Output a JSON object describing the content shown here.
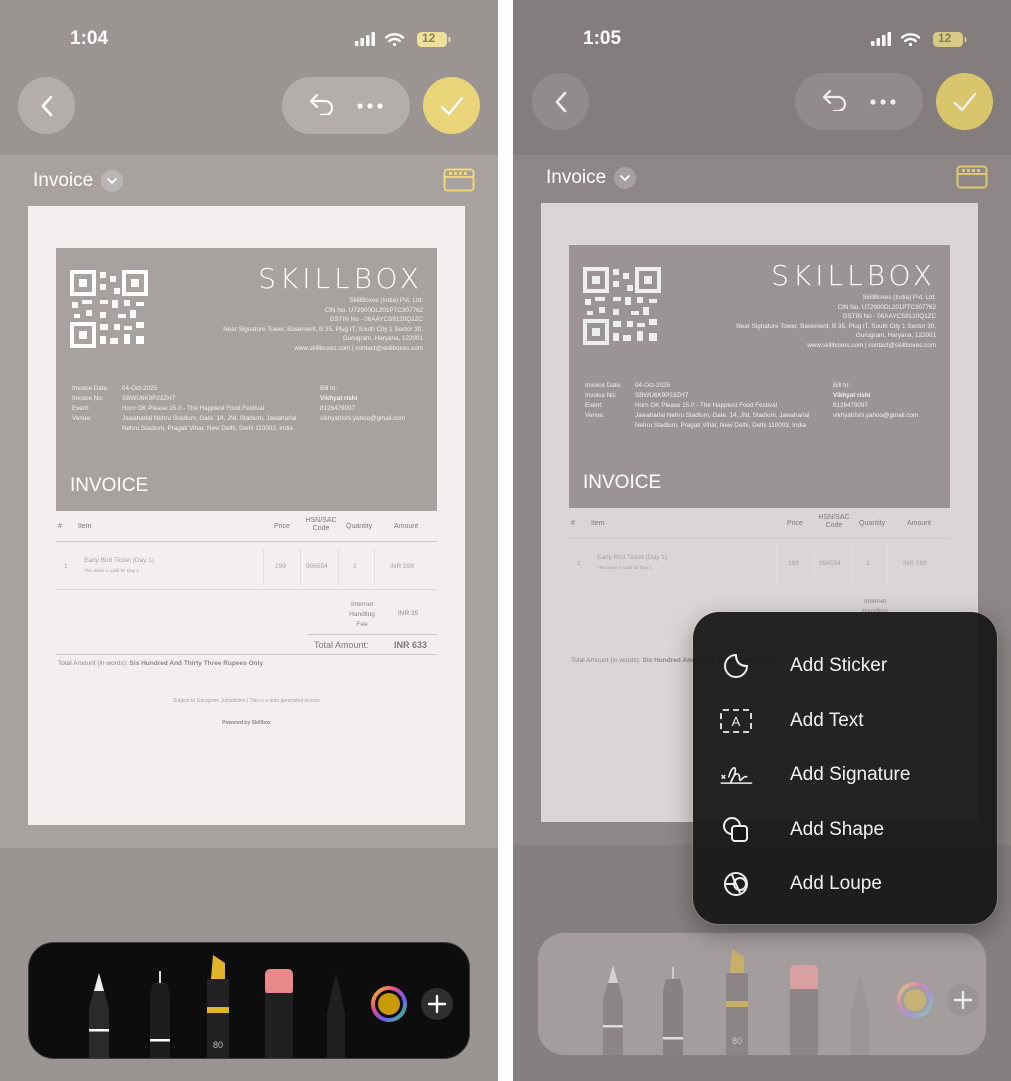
{
  "panels": [
    {
      "time": "1:04",
      "battery": "12",
      "doc_title": "Invoice",
      "document": {
        "brand": "SKILLBOX",
        "company_lines": [
          "SkillBoxes (India) Pvt. Ltd.",
          "CIN No. U72900DL201PTC307762",
          "GSTIN No - 06AAYCS9120Q1ZC",
          "Near Signature Tower, Basement, B 35, Plug IT, South City 1 Sector 30,",
          "Gurugram, Haryana, 122001",
          "www.skillboxes.com | contact@skillboxes.com"
        ],
        "meta": [
          {
            "label": "Invoice Date:",
            "value": "04-Oct-2025"
          },
          {
            "label": "Invoice No:",
            "value": "SBWU6K9P23ZH7"
          },
          {
            "label": "Event:",
            "value": "Horn OK Please 15.0 - The Happiest Food Festival"
          },
          {
            "label": "Venue:",
            "value": "Jawaharlal Nehru Stadium, Gate. 14, JNL Stadium, Jawaharlal Nehru Stadium, Pragati Vihar, New Delhi, Delhi 110003, India"
          }
        ],
        "bill_to": {
          "label": "Bill to:",
          "name": "Vikhyat rishi",
          "phone": "8126479097",
          "email": "vikhyatrishi.yahoo@gmail.com"
        },
        "invoice_label": "INVOICE",
        "columns": [
          "#",
          "Item",
          "Price",
          "HSN/SAC Code",
          "Quantity",
          "Amount"
        ],
        "row": {
          "num": "1",
          "item": "Early Bird Ticket (Day 1)",
          "note": "This ticket is valid for Day 1.",
          "price": "299",
          "code": "996554",
          "qty": "2",
          "amount": "INR 598"
        },
        "fee_label": "Internet Handling Fee",
        "fee_amount": "INR 35",
        "total_label": "Total Amount:",
        "total_value": "INR 633",
        "words_label": "Total Amount (in words):",
        "words_value": "Six Hundred And Thirty Three Rupees Only",
        "footer": "Subject to Gurugram Jurisdiction | This is a auto generated invoice",
        "powered": "Powered by Skillbox"
      },
      "marker_width": "80"
    },
    {
      "time": "1:05",
      "battery": "12",
      "doc_title": "Invoice",
      "marker_width": "80"
    }
  ],
  "menu": [
    {
      "label": "Add Sticker",
      "icon": "sticker-icon"
    },
    {
      "label": "Add Text",
      "icon": "text-box-icon"
    },
    {
      "label": "Add Signature",
      "icon": "signature-icon"
    },
    {
      "label": "Add Shape",
      "icon": "shape-icon"
    },
    {
      "label": "Add Loupe",
      "icon": "loupe-icon"
    }
  ],
  "colors": {
    "done_button": "#e9d47a",
    "menu_bg": "#161616",
    "toolbar_bg": "#0d0d0d",
    "highlighter": "#e0b52a",
    "eraser": "#e8888b"
  }
}
